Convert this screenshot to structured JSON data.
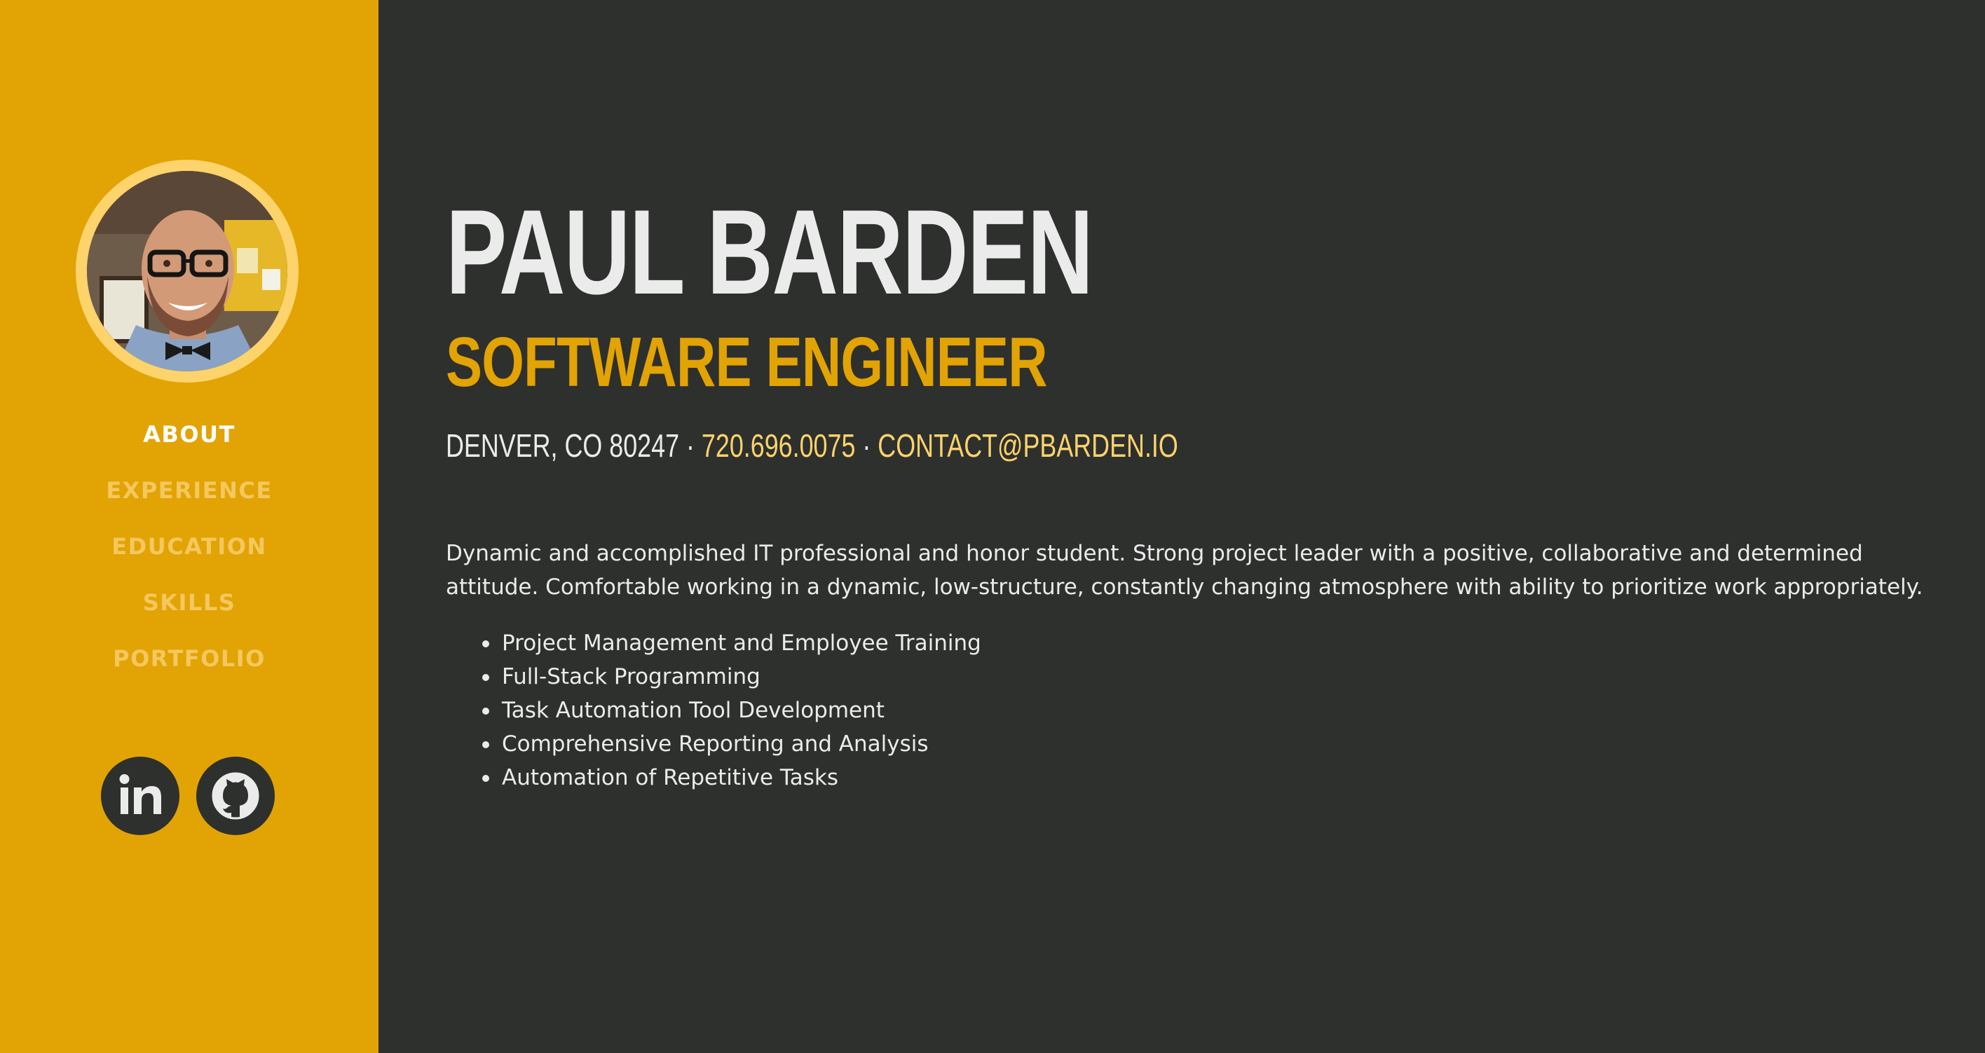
{
  "sidebar": {
    "nav": [
      {
        "label": "ABOUT",
        "active": true
      },
      {
        "label": "EXPERIENCE",
        "active": false
      },
      {
        "label": "EDUCATION",
        "active": false
      },
      {
        "label": "SKILLS",
        "active": false
      },
      {
        "label": "PORTFOLIO",
        "active": false
      }
    ],
    "social": [
      {
        "icon": "linkedin-icon"
      },
      {
        "icon": "github-icon"
      }
    ]
  },
  "main": {
    "name": "PAUL BARDEN",
    "title": "SOFTWARE ENGINEER",
    "contact": {
      "location": "DENVER, CO 80247",
      "separator": " · ",
      "phone": "720.696.0075",
      "email": "CONTACT@PBARDEN.IO"
    },
    "summary": "Dynamic and accomplished IT professional and honor student. Strong project leader with a positive, collaborative and determined attitude. Comfortable working in a dynamic, low-structure, constantly changing atmosphere with ability to prioritize work appropriately.",
    "highlights": [
      "Project Management and Employee Training",
      "Full-Stack Programming",
      "Task Automation Tool Development",
      "Comprehensive Reporting and Analysis",
      "Automation of Repetitive Tasks"
    ]
  },
  "colors": {
    "sidebar_bg": "#e2a304",
    "main_bg": "#2e302e",
    "accent": "#e2a304",
    "accent_light": "#fdd36b",
    "text": "#ebebeb",
    "nav_inactive": "#f4c85f"
  }
}
